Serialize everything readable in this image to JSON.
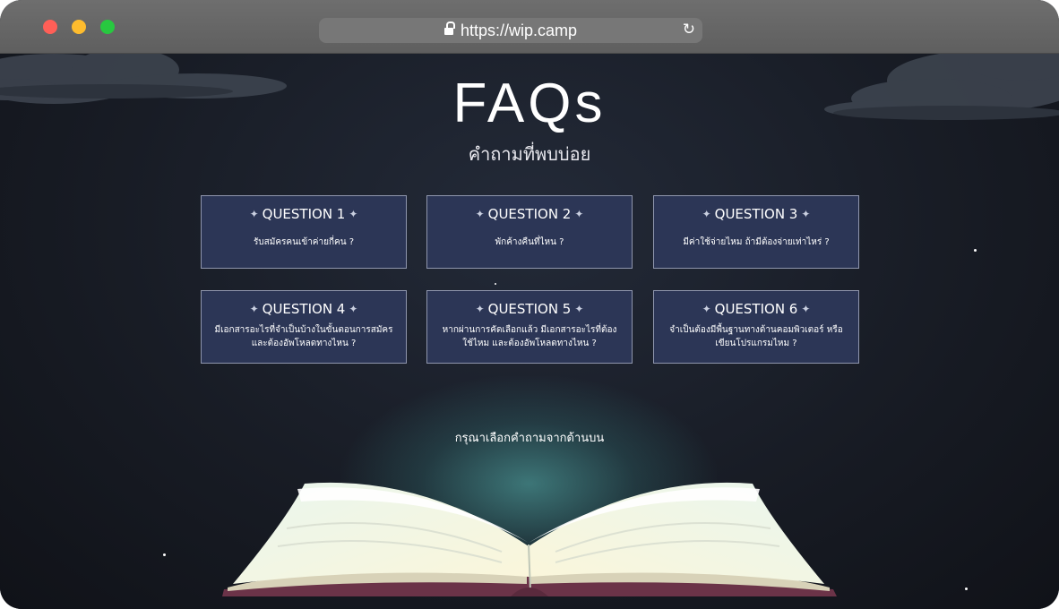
{
  "browser": {
    "url": "https://wip.camp"
  },
  "page": {
    "title": "FAQs",
    "subtitle": "คำถามที่พบบ่อย",
    "prompt": "กรุณาเลือกคำถามจากด้านบน"
  },
  "faq": [
    {
      "label": "QUESTION 1",
      "question": "รับสมัครคนเข้าค่ายกี่คน ?"
    },
    {
      "label": "QUESTION 2",
      "question": "พักค้างคืนที่ไหน ?"
    },
    {
      "label": "QUESTION 3",
      "question": "มีค่าใช้จ่ายไหม ถ้ามีต้องจ่ายเท่าไหร่ ?"
    },
    {
      "label": "QUESTION 4",
      "question": "มีเอกสารอะไรที่จำเป็นบ้างในขั้นตอนการสมัคร และต้องอัพโหลดทางไหน ?"
    },
    {
      "label": "QUESTION 5",
      "question": "หากผ่านการคัดเลือกแล้ว มีเอกสารอะไรที่ต้องใช้ไหม และต้องอัพโหลดทางไหน ?"
    },
    {
      "label": "QUESTION 6",
      "question": "จำเป็นต้องมีพื้นฐานทางด้านคอมพิวเตอร์ หรือเขียนโปรแกรมไหม ?"
    }
  ],
  "icons": {
    "card_ornament": "four-point-sparkle-icon",
    "url_lock": "lock-icon",
    "url_reload": "reload-icon"
  },
  "colors": {
    "background": "#181c25",
    "card_fill": "#2c3656",
    "card_border": "#8f96ad",
    "glow": "#5abeb9",
    "book_cover": "#6b3348"
  }
}
